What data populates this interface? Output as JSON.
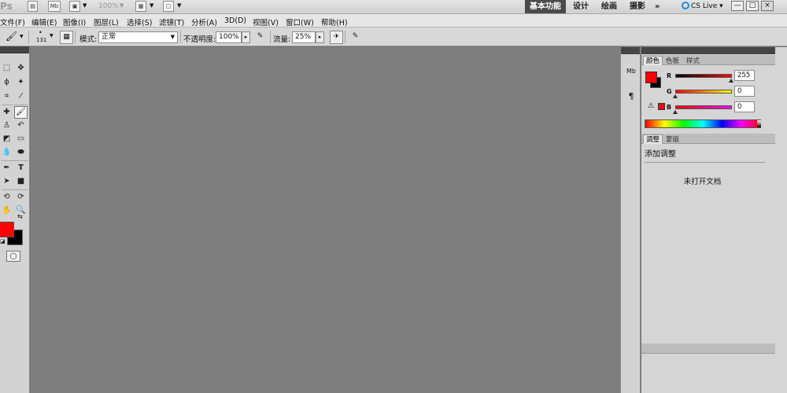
{
  "app": {
    "logo": "Ps",
    "toolbar_icons": [
      "Mb"
    ],
    "zoom": "100%",
    "workspaces": [
      "基本功能",
      "设计",
      "绘画",
      "摄影"
    ],
    "more": "»",
    "cs_live": "CS Live",
    "window_buttons": [
      "—",
      "□",
      "×"
    ]
  },
  "menu": [
    "文件(F)",
    "编辑(E)",
    "图像(I)",
    "图层(L)",
    "选择(S)",
    "滤镜(T)",
    "分析(A)",
    "3D(D)",
    "视图(V)",
    "窗口(W)",
    "帮助(H)"
  ],
  "options": {
    "brush_size": "131",
    "mode_label": "模式:",
    "mode_value": "正常",
    "opacity_label": "不透明度:",
    "opacity_value": "100%",
    "flow_label": "流量:",
    "flow_value": "25%"
  },
  "colors": {
    "foreground": "#ff0000",
    "background": "#000000"
  },
  "color_panel": {
    "tabs": [
      "颜色",
      "色板",
      "样式"
    ],
    "channels": [
      {
        "label": "R",
        "value": "255"
      },
      {
        "label": "G",
        "value": "0"
      },
      {
        "label": "B",
        "value": "0"
      }
    ]
  },
  "adjust_panel": {
    "tabs": [
      "调整",
      "蒙版"
    ],
    "title": "添加调整",
    "empty_message": "未打开文档"
  },
  "strip": {
    "icon1": "Mb",
    "icon2": "¶"
  }
}
